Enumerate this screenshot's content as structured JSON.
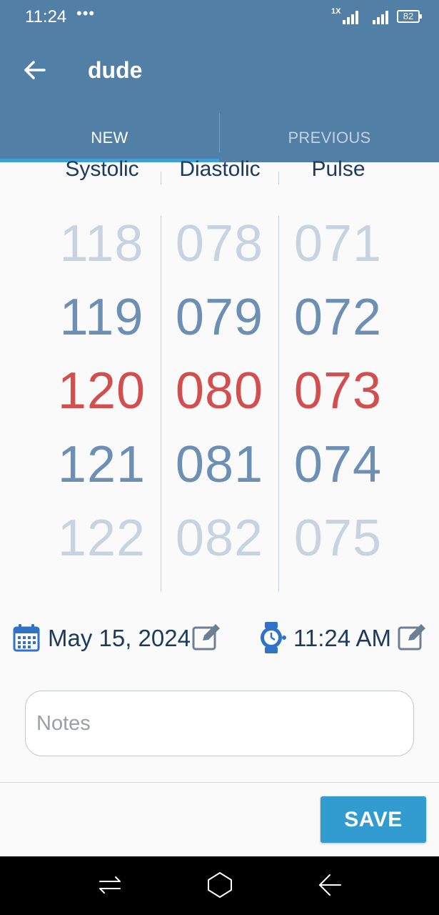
{
  "status_bar": {
    "time": "11:24",
    "dots": "•••",
    "network_label": "1X",
    "battery": "82"
  },
  "app_bar": {
    "title": "dude",
    "back_icon": "arrow-left-icon"
  },
  "tabs": [
    {
      "label": "NEW",
      "selected": true
    },
    {
      "label": "PREVIOUS",
      "selected": false
    }
  ],
  "picker": {
    "columns": [
      {
        "header": "Systolic",
        "values": [
          "118",
          "119",
          "120",
          "121",
          "122"
        ],
        "selected": "120"
      },
      {
        "header": "Diastolic",
        "values": [
          "078",
          "079",
          "080",
          "081",
          "082"
        ],
        "selected": "080"
      },
      {
        "header": "Pulse",
        "values": [
          "071",
          "072",
          "073",
          "074",
          "075"
        ],
        "selected": "073"
      }
    ]
  },
  "datetime": {
    "date": "May 15, 2024",
    "time": "11:24 AM",
    "date_icon": "calendar-icon",
    "time_icon": "watch-icon",
    "edit_icon": "edit-icon"
  },
  "notes": {
    "placeholder": "Notes",
    "value": ""
  },
  "actions": {
    "save_label": "SAVE"
  },
  "colors": {
    "app_bar": "#527fa6",
    "tab_indicator": "#3fa0d8",
    "selected_value": "#d24f4f",
    "near_value": "#6d8fb3",
    "far_value": "#c7d3e0",
    "save_button": "#329bd0",
    "icon_blue": "#2f72c8"
  }
}
